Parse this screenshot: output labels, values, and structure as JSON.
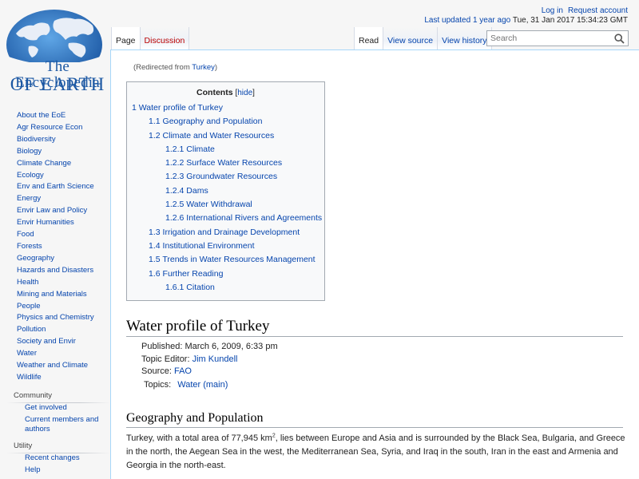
{
  "personal": {
    "login": "Log in",
    "request_account": "Request account",
    "last_updated_link": "Last updated 1 year ago",
    "timestamp": "Tue, 31 Jan 2017 15:34:23 GMT"
  },
  "logo": {
    "line1": "The Encyclopedia",
    "line2": "OF EARTH",
    "color": "#1b57a3"
  },
  "sidebar": {
    "items": [
      {
        "label": "About the EoE"
      },
      {
        "label": "Agr Resource Econ"
      },
      {
        "label": "Biodiversity"
      },
      {
        "label": "Biology"
      },
      {
        "label": "Climate Change"
      },
      {
        "label": "Ecology"
      },
      {
        "label": "Env and Earth Science"
      },
      {
        "label": "Energy"
      },
      {
        "label": "Envir Law and Policy"
      },
      {
        "label": "Envir Humanities"
      },
      {
        "label": "Food"
      },
      {
        "label": "Forests"
      },
      {
        "label": "Geography"
      },
      {
        "label": "Hazards and Disasters"
      },
      {
        "label": "Health"
      },
      {
        "label": "Mining and Materials"
      },
      {
        "label": "People"
      },
      {
        "label": "Physics and Chemistry"
      },
      {
        "label": "Pollution"
      },
      {
        "label": "Society and Envir"
      },
      {
        "label": "Water"
      },
      {
        "label": "Weather and Climate"
      },
      {
        "label": "Wildlife"
      }
    ],
    "community": {
      "heading": "Community",
      "items": [
        {
          "label": "Get involved"
        },
        {
          "label": "Current members and authors"
        }
      ]
    },
    "utility": {
      "heading": "Utility",
      "items": [
        {
          "label": "Recent changes"
        },
        {
          "label": "Help"
        }
      ]
    }
  },
  "tabs": {
    "page": "Page",
    "discussion": "Discussion",
    "read": "Read",
    "view_source": "View source",
    "view_history": "View history"
  },
  "search": {
    "placeholder": "Search",
    "icon": "search-icon"
  },
  "content": {
    "redirect_prefix": "(Redirected from ",
    "redirect_link": "Turkey",
    "redirect_suffix": ")",
    "toc": {
      "title": "Contents",
      "hide_open": "[",
      "hide_label": "hide",
      "hide_close": "]",
      "entries": [
        {
          "num": "1",
          "text": "Water profile of Turkey",
          "level": 1
        },
        {
          "num": "1.1",
          "text": "Geography and Population",
          "level": 2
        },
        {
          "num": "1.2",
          "text": "Climate and Water Resources",
          "level": 2
        },
        {
          "num": "1.2.1",
          "text": "Climate",
          "level": 3
        },
        {
          "num": "1.2.2",
          "text": "Surface Water Resources",
          "level": 3
        },
        {
          "num": "1.2.3",
          "text": "Groundwater Resources",
          "level": 3
        },
        {
          "num": "1.2.4",
          "text": "Dams",
          "level": 3
        },
        {
          "num": "1.2.5",
          "text": "Water Withdrawal",
          "level": 3
        },
        {
          "num": "1.2.6",
          "text": "International Rivers and Agreements",
          "level": 3
        },
        {
          "num": "1.3",
          "text": "Irrigation and Drainage Development",
          "level": 2
        },
        {
          "num": "1.4",
          "text": "Institutional Environment",
          "level": 2
        },
        {
          "num": "1.5",
          "text": "Trends in Water Resources Management",
          "level": 2
        },
        {
          "num": "1.6",
          "text": "Further Reading",
          "level": 2
        },
        {
          "num": "1.6.1",
          "text": "Citation",
          "level": 3
        }
      ]
    },
    "heading": "Water profile of Turkey",
    "meta": {
      "published_label": "Published: ",
      "published_value": "March 6, 2009, 6:33 pm",
      "editor_label": "Topic Editor: ",
      "editor_value": "Jim Kundell",
      "source_label": "Source: ",
      "source_value": "FAO",
      "topics_label": "Topics:",
      "topics_value": "Water (main)"
    },
    "section_heading": "Geography and Population",
    "paragraph_before": "Turkey, with a total area of 77,945 km",
    "paragraph_sup": "2",
    "paragraph_after": ", lies between Europe and Asia and is surrounded by the Black Sea, Bulgaria, and Greece in the north, the Aegean Sea in the west, the Mediterranean Sea, Syria, and Iraq in the south, Iran in the east and Armenia and Georgia in the north-east."
  }
}
